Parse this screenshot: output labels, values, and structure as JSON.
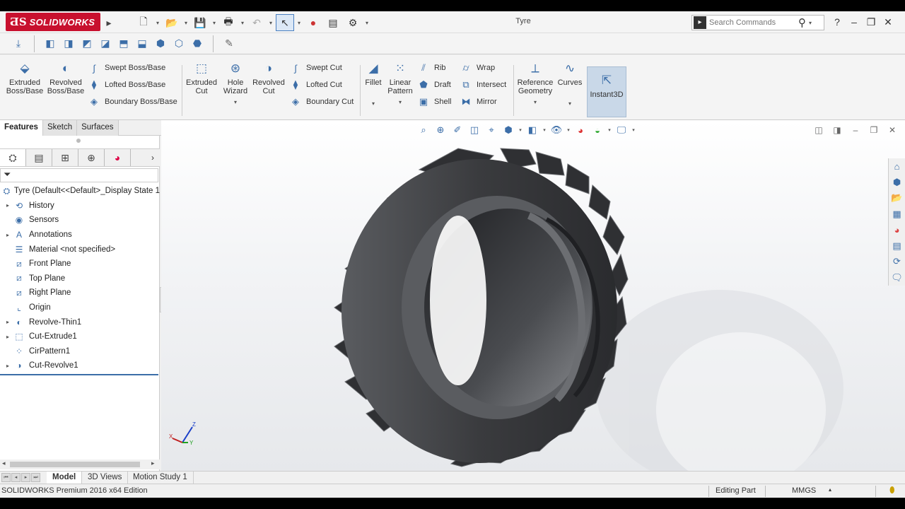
{
  "window": {
    "brand": "SOLIDWORKS",
    "document_title": "Tyre"
  },
  "search": {
    "placeholder": "Search Commands"
  },
  "command_manager": {
    "extruded_boss": "Extruded Boss/Base",
    "revolved_boss": "Revolved Boss/Base",
    "swept_boss": "Swept Boss/Base",
    "lofted_boss": "Lofted Boss/Base",
    "boundary_boss": "Boundary Boss/Base",
    "extruded_cut": "Extruded Cut",
    "hole_wizard": "Hole Wizard",
    "revolved_cut": "Revolved Cut",
    "swept_cut": "Swept Cut",
    "lofted_cut": "Lofted Cut",
    "boundary_cut": "Boundary Cut",
    "fillet": "Fillet",
    "linear_pattern": "Linear Pattern",
    "rib": "Rib",
    "draft": "Draft",
    "shell": "Shell",
    "wrap": "Wrap",
    "intersect": "Intersect",
    "mirror": "Mirror",
    "reference_geometry": "Reference Geometry",
    "curves": "Curves",
    "instant3d": "Instant3D"
  },
  "tabs": [
    "Features",
    "Sketch",
    "Surfaces"
  ],
  "feature_tree": {
    "root": "Tyre  (Default<<Default>_Display State 1",
    "nodes": [
      {
        "label": "History",
        "icon": "history-icon",
        "expandable": true
      },
      {
        "label": "Sensors",
        "icon": "sensors-icon",
        "expandable": false
      },
      {
        "label": "Annotations",
        "icon": "annotations-icon",
        "expandable": true
      },
      {
        "label": "Material <not specified>",
        "icon": "material-icon",
        "expandable": false
      },
      {
        "label": "Front Plane",
        "icon": "plane-icon",
        "expandable": false
      },
      {
        "label": "Top Plane",
        "icon": "plane-icon",
        "expandable": false
      },
      {
        "label": "Right Plane",
        "icon": "plane-icon",
        "expandable": false
      },
      {
        "label": "Origin",
        "icon": "origin-icon",
        "expandable": false
      },
      {
        "label": "Revolve-Thin1",
        "icon": "revolve-icon",
        "expandable": true
      },
      {
        "label": "Cut-Extrude1",
        "icon": "cut-extrude-icon",
        "expandable": true
      },
      {
        "label": "CirPattern1",
        "icon": "pattern-icon",
        "expandable": false
      },
      {
        "label": "Cut-Revolve1",
        "icon": "cut-revolve-icon",
        "expandable": true
      }
    ]
  },
  "bottom_tabs": [
    "Model",
    "3D Views",
    "Motion Study 1"
  ],
  "status": {
    "edition": "SOLIDWORKS Premium 2016 x64 Edition",
    "mode": "Editing Part",
    "units": "MMGS"
  },
  "triad": {
    "z": "Z",
    "x": "X",
    "y": "Y"
  },
  "colors": {
    "brand_red": "#c8102e",
    "accent_blue": "#3c6ea8",
    "tire_dark": "#3a3b3e"
  }
}
